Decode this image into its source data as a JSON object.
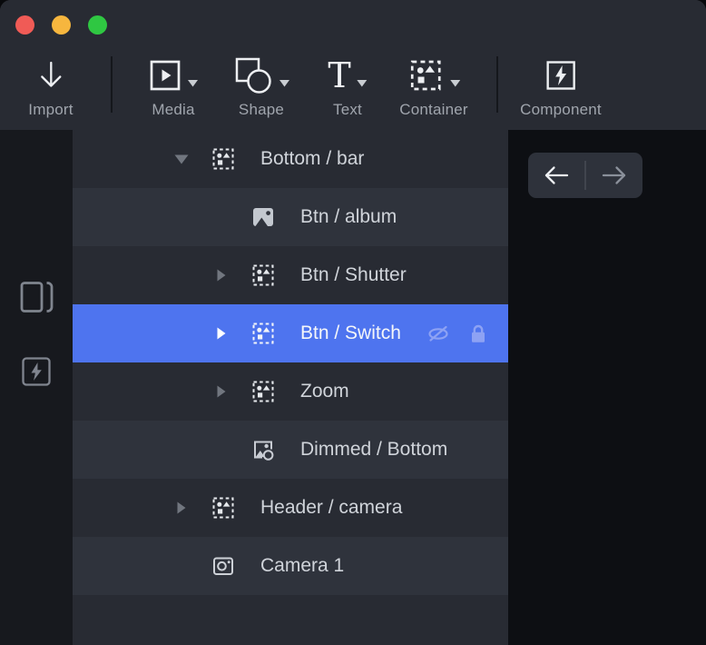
{
  "colors": {
    "accent_blue": "#4E74EF",
    "panel_dark": "#282B33",
    "panel_alt": "#2F333C",
    "traffic_red": "#F05B56",
    "traffic_yellow": "#F6B63E",
    "traffic_green": "#2FC742"
  },
  "titlebar": {
    "buttons": [
      "close",
      "minimize",
      "fullscreen"
    ]
  },
  "toolbar": {
    "items": [
      {
        "label": "Import",
        "icon": "import-arrow-icon"
      },
      {
        "label": "Media",
        "icon": "media-icon",
        "has_caret": true
      },
      {
        "label": "Shape",
        "icon": "shape-icon",
        "has_caret": true
      },
      {
        "label": "Text",
        "icon": "text-icon",
        "glyph": "T",
        "has_caret": true
      },
      {
        "label": "Container",
        "icon": "container-icon",
        "has_caret": true
      },
      {
        "label": "Component",
        "icon": "component-icon"
      }
    ]
  },
  "left_rail": {
    "icons": [
      "preview-panels-icon",
      "component-panel-icon"
    ]
  },
  "layer_panel": {
    "items": [
      {
        "label": "Bottom / bar",
        "type": "container",
        "state": "expanded",
        "level": 0
      },
      {
        "label": "Btn / album",
        "type": "image",
        "level": 1
      },
      {
        "label": "Btn / Shutter",
        "type": "container",
        "state": "collapsed",
        "level": 1
      },
      {
        "label": "Btn / Switch",
        "type": "container",
        "state": "collapsed",
        "level": 1,
        "selected": true,
        "hidden": true,
        "locked": true
      },
      {
        "label": "Zoom",
        "type": "container",
        "state": "collapsed",
        "level": 1
      },
      {
        "label": "Dimmed / Bottom",
        "type": "image-mask",
        "level": 1
      },
      {
        "label": "Header / camera",
        "type": "container",
        "state": "collapsed",
        "level": 0
      },
      {
        "label": "Camera 1",
        "type": "camera",
        "level": 0
      }
    ]
  },
  "history": {
    "back": "arrow-left-icon",
    "forward": "arrow-right-icon"
  }
}
